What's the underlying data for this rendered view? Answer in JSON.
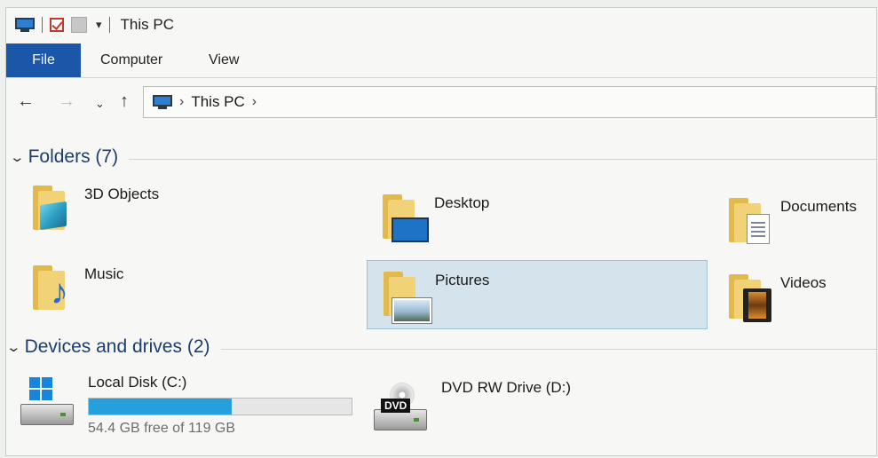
{
  "quick_access": {
    "title": "This PC",
    "dropdown_glyph": "▾"
  },
  "ribbon": {
    "tabs": [
      {
        "label": "File",
        "active": true
      },
      {
        "label": "Computer"
      },
      {
        "label": "View"
      }
    ],
    "accent_color": "#1b56a8"
  },
  "navigation": {
    "back_glyph": "←",
    "forward_glyph": "→",
    "recent_glyph": "⌄",
    "up_glyph": "↑",
    "address": {
      "path": [
        "This PC"
      ],
      "separator": "›"
    }
  },
  "groups": {
    "folders": {
      "header": "Folders (7)",
      "items": [
        {
          "label": "3D Objects",
          "icon": "3d-objects-folder-icon"
        },
        {
          "label": "Desktop",
          "icon": "desktop-folder-icon"
        },
        {
          "label": "Documents",
          "icon": "documents-folder-icon"
        },
        {
          "label": "Music",
          "icon": "music-folder-icon"
        },
        {
          "label": "Pictures",
          "icon": "pictures-folder-icon",
          "selected": true
        },
        {
          "label": "Videos",
          "icon": "videos-folder-icon"
        }
      ]
    },
    "devices": {
      "header": "Devices and drives (2)",
      "drives": [
        {
          "label": "Local Disk (C:)",
          "free_text": "54.4 GB free of 119 GB",
          "used_fraction": 0.543,
          "bar_color": "#26a0da",
          "icon": "hard-drive-windows-icon"
        },
        {
          "label": "DVD RW Drive (D:)",
          "icon": "dvd-drive-icon",
          "badge": "DVD"
        }
      ]
    }
  }
}
